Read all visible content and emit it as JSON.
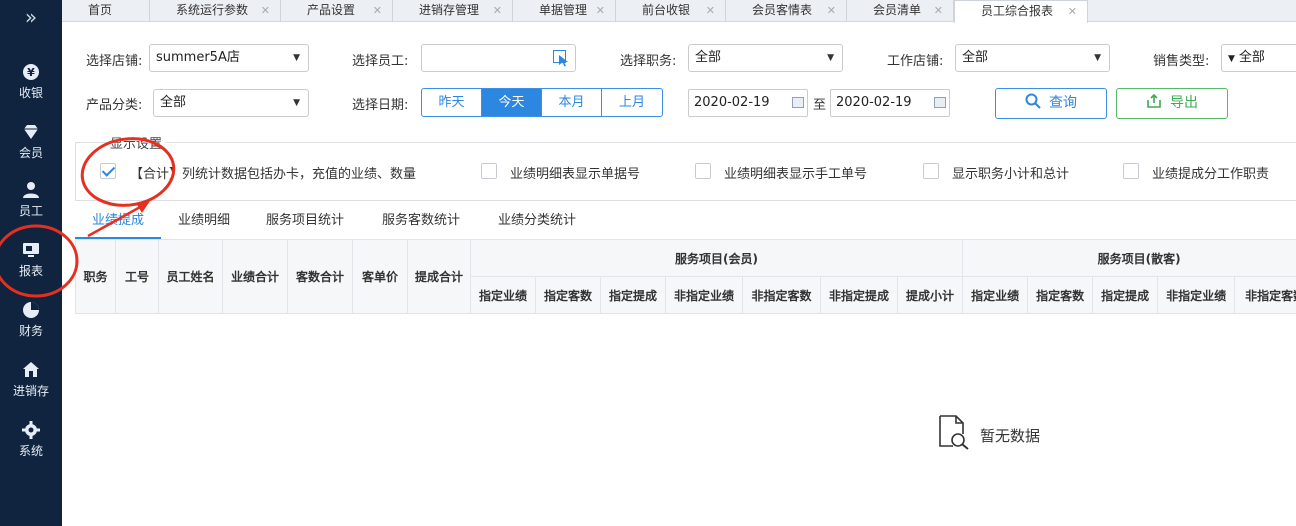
{
  "sidebar": {
    "items": [
      {
        "label": "收银",
        "icon": "yen-icon"
      },
      {
        "label": "会员",
        "icon": "diamond-icon"
      },
      {
        "label": "员工",
        "icon": "user-icon"
      },
      {
        "label": "报表",
        "icon": "report-icon"
      },
      {
        "label": "财务",
        "icon": "pie-icon"
      },
      {
        "label": "进销存",
        "icon": "home-icon"
      },
      {
        "label": "系统",
        "icon": "gear-icon"
      }
    ]
  },
  "tabs": [
    {
      "label": "首页"
    },
    {
      "label": "系统运行参数"
    },
    {
      "label": "产品设置"
    },
    {
      "label": "进销存管理"
    },
    {
      "label": "单据管理"
    },
    {
      "label": "前台收银"
    },
    {
      "label": "会员客情表"
    },
    {
      "label": "会员清单"
    },
    {
      "label": "员工综合报表"
    }
  ],
  "filters": {
    "store_label": "选择店铺:",
    "store_value": "summer5A店",
    "employee_label": "选择员工:",
    "position_label": "选择职务:",
    "position_value": "全部",
    "work_store_label": "工作店铺:",
    "work_store_value": "全部",
    "sales_type_label": "销售类型:",
    "sales_type_value": "全部",
    "category_label": "产品分类:",
    "category_value": "全部",
    "date_label": "选择日期:",
    "date_buttons": [
      "昨天",
      "今天",
      "本月",
      "上月"
    ],
    "date_from": "2020-02-19",
    "date_sep": "至",
    "date_to": "2020-02-19",
    "query_label": "查询",
    "export_label": "导出"
  },
  "display": {
    "legend": "显示设置",
    "options": [
      {
        "label": "【合计】列统计数据包括办卡，充值的业绩、数量",
        "checked": true
      },
      {
        "label": "业绩明细表显示单据号",
        "checked": false
      },
      {
        "label": "业绩明细表显示手工单号",
        "checked": false
      },
      {
        "label": "显示职务小计和总计",
        "checked": false
      },
      {
        "label": "业绩提成分工作职责",
        "checked": false
      }
    ]
  },
  "subtabs": [
    "业绩提成",
    "业绩明细",
    "服务项目统计",
    "服务客数统计",
    "业绩分类统计"
  ],
  "table": {
    "fixed_headers": [
      "职务",
      "工号",
      "员工姓名",
      "业绩合计",
      "客数合计",
      "客单价",
      "提成合计"
    ],
    "group1": "服务项目(会员)",
    "group1_cols": [
      "指定业绩",
      "指定客数",
      "指定提成",
      "非指定业绩",
      "非指定客数",
      "非指定提成",
      "提成小计"
    ],
    "group2": "服务项目(散客)",
    "group2_cols": [
      "指定业绩",
      "指定客数",
      "指定提成",
      "非指定业绩",
      "非指定客数"
    ]
  },
  "empty_text": "暂无数据",
  "colors": {
    "sidebar_bg": "#10243f",
    "accent": "#2d86e0",
    "export": "#3eaa52",
    "annotation": "#e53020"
  }
}
